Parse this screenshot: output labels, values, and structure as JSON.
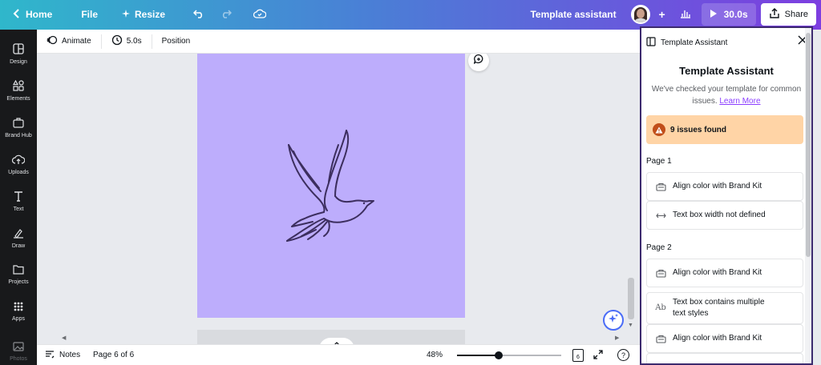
{
  "topbar": {
    "home_label": "Home",
    "file_label": "File",
    "resize_label": "Resize",
    "template_assistant_label": "Template assistant",
    "duration_label": "30.0s",
    "share_label": "Share",
    "add_label": "+"
  },
  "sidebar": {
    "items": [
      {
        "label": "Design",
        "icon": "layout-icon"
      },
      {
        "label": "Elements",
        "icon": "shapes-icon"
      },
      {
        "label": "Brand Hub",
        "icon": "briefcase-icon"
      },
      {
        "label": "Uploads",
        "icon": "cloud-upload-icon"
      },
      {
        "label": "Text",
        "icon": "text-icon"
      },
      {
        "label": "Draw",
        "icon": "pen-icon"
      },
      {
        "label": "Projects",
        "icon": "folder-icon"
      },
      {
        "label": "Apps",
        "icon": "apps-grid-icon"
      },
      {
        "label": "Photos",
        "icon": "image-icon"
      }
    ]
  },
  "toolbar": {
    "animate_label": "Animate",
    "timing_label": "5.0s",
    "position_label": "Position"
  },
  "bottombar": {
    "notes_label": "Notes",
    "page_indicator": "Page 6 of 6",
    "zoom_label": "48%",
    "zoom_fraction": 0.4,
    "page_count_badge": "6",
    "help_label": "?"
  },
  "panel": {
    "header_label": "Template Assistant",
    "title": "Template Assistant",
    "description": "We've checked your template for common issues.",
    "learn_more_label": "Learn More",
    "issues_found_label": "9 issues found",
    "sections": [
      {
        "heading": "Page 1",
        "issues": [
          {
            "label": "Align color with Brand Kit",
            "icon": "brand-kit-icon"
          },
          {
            "label": "Text box width not defined",
            "icon": "width-arrows-icon"
          }
        ]
      },
      {
        "heading": "Page 2",
        "issues": [
          {
            "label": "Align color with Brand Kit",
            "icon": "brand-kit-icon"
          },
          {
            "label": "Text box contains multiple text styles",
            "icon": "text-styles-icon"
          },
          {
            "label": "Align color with Brand Kit",
            "icon": "brand-kit-icon"
          }
        ]
      }
    ]
  },
  "colors": {
    "page_background": "#bdadfc",
    "accent": "#8b3dff",
    "warning_banner": "#ffd4a6",
    "panel_border": "#3c2a6e"
  }
}
